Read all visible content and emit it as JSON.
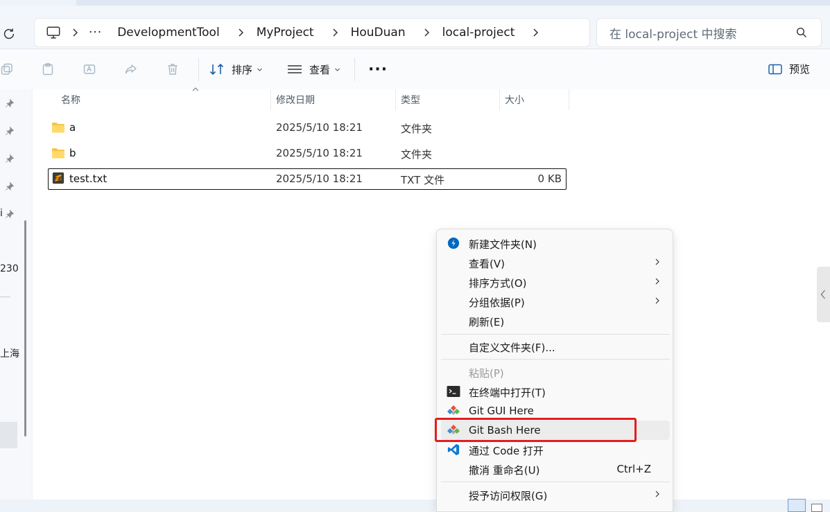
{
  "address": {
    "overflow": "···",
    "crumbs": [
      "DevelopmentTool",
      "MyProject",
      "HouDuan",
      "local-project"
    ]
  },
  "search": {
    "placeholder": "在 local-project 中搜索"
  },
  "toolbar": {
    "sort_label": "排序",
    "view_label": "查看",
    "more_label": "···",
    "preview_label": "预览"
  },
  "nav_fragments": {
    "item_a": "i",
    "item_b": "230",
    "item_c": "上海"
  },
  "columns": {
    "name": "名称",
    "date": "修改日期",
    "type": "类型",
    "size": "大小"
  },
  "files": [
    {
      "name": "a",
      "date": "2025/5/10 18:21",
      "type": "文件夹",
      "size": "",
      "kind": "folder-icon"
    },
    {
      "name": "b",
      "date": "2025/5/10 18:21",
      "type": "文件夹",
      "size": "",
      "kind": "folder-icon"
    },
    {
      "name": "test.txt",
      "date": "2025/5/10 18:21",
      "type": "TXT 文件",
      "size": "0 KB",
      "kind": "sublime-file-icon"
    }
  ],
  "context_menu": {
    "new_folder": "新建文件夹(N)",
    "view": "查看(V)",
    "sort_by": "排序方式(O)",
    "group_by": "分组依据(P)",
    "refresh": "刷新(E)",
    "customize": "自定义文件夹(F)...",
    "paste": "粘贴(P)",
    "open_terminal": "在终端中打开(T)",
    "git_gui": "Git GUI Here",
    "git_bash": "Git Bash Here",
    "open_code": "通过 Code 打开",
    "undo_rename": "撤消 重命名(U)",
    "undo_shortcut": "Ctrl+Z",
    "give_access": "授予访问权限(G)"
  },
  "colors": {
    "accent": "#0067c0",
    "highlight_box": "#e41c1c",
    "folder": "#f4c542"
  }
}
